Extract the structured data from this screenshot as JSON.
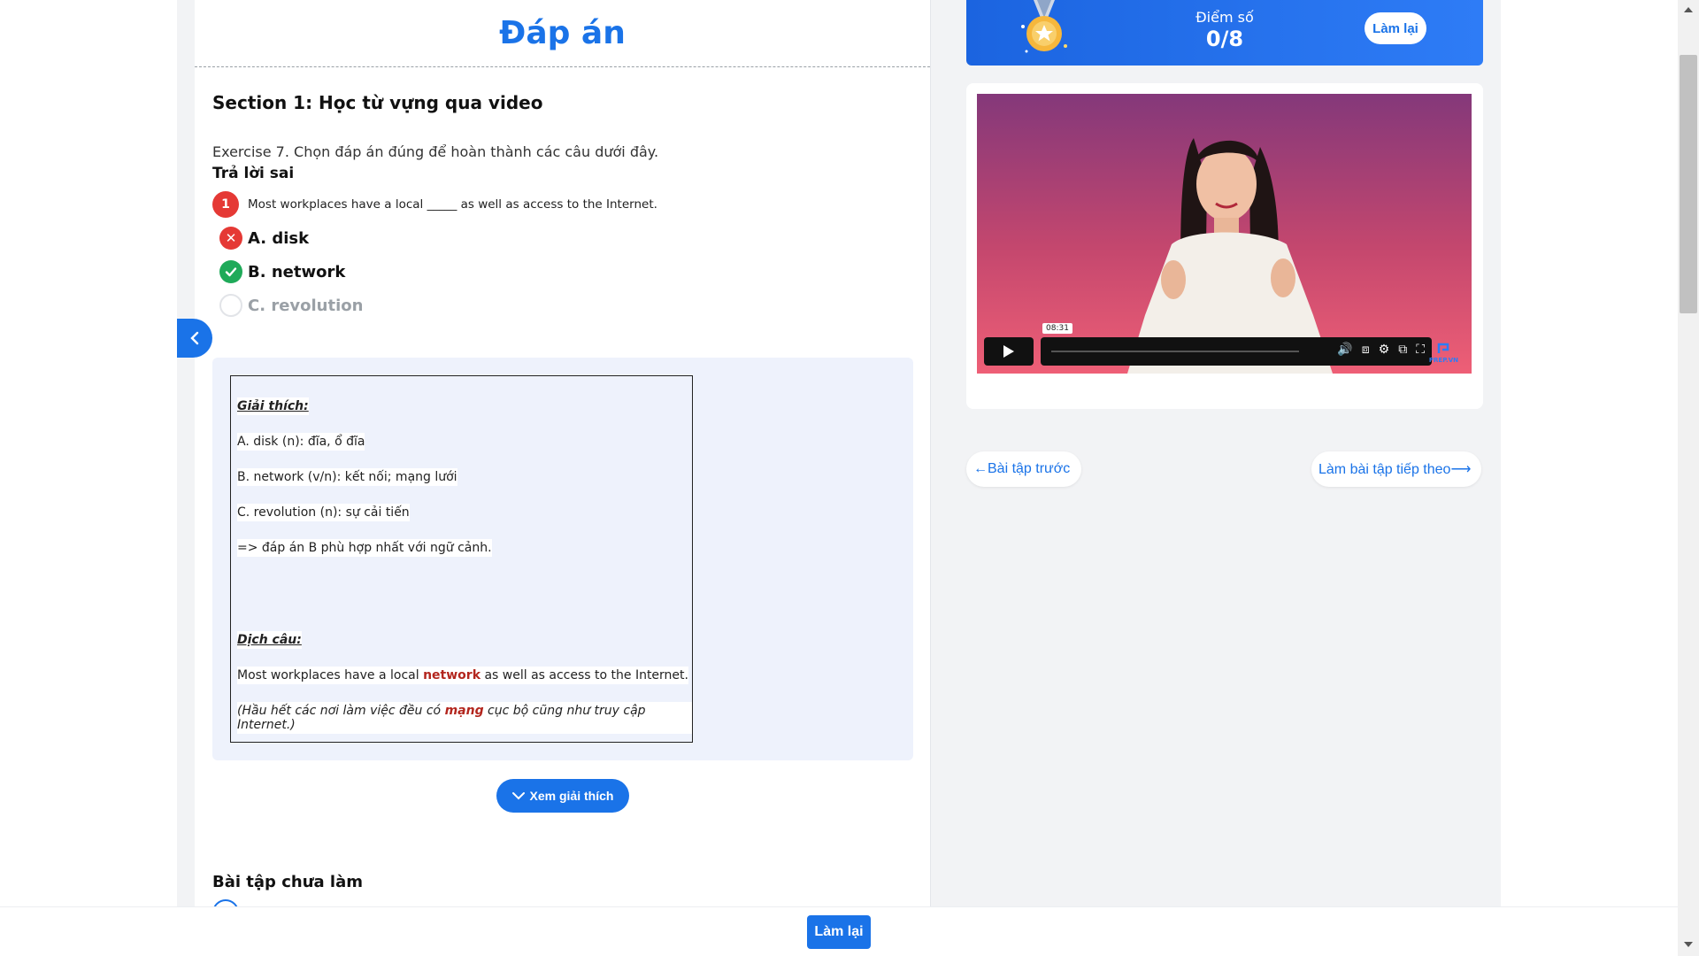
{
  "header": {
    "title": "Đáp án"
  },
  "section": {
    "title": "Section 1: Học từ vựng qua video"
  },
  "exercise": {
    "description": "Exercise 7. Chọn đáp án đúng để hoàn thành các câu dưới đây.",
    "result_label": "Trả lời sai",
    "question": {
      "number": "1",
      "text": "Most workplaces have a local _____ as well as access to the Internet.",
      "options": [
        {
          "label": "A. disk",
          "status": "wrong"
        },
        {
          "label": "B. network",
          "status": "correct"
        },
        {
          "label": "C. revolution",
          "status": "unselected"
        }
      ]
    },
    "explanation": {
      "heading": "Giải thích:",
      "lines": [
        "A. disk (n): đĩa, ổ đĩa",
        "B. network (v/n): kết nối; mạng lưới",
        "C. revolution (n): sự cải tiến",
        "=> đáp án B phù hợp nhất với ngữ cảnh."
      ],
      "translation_heading": "Dịch câu:",
      "sentence_before": "Most workplaces have a local ",
      "sentence_highlight": "network",
      "sentence_after": " as well as access to the Internet.",
      "translation_before": "(Hầu hết các nơi làm việc đều có ",
      "translation_highlight": "mạng",
      "translation_after": " cục bộ cũng như truy cập Internet.)"
    },
    "toggle_label": "Xem giải thích"
  },
  "unanswered": {
    "label": "Bài tập chưa làm"
  },
  "score": {
    "label": "Điểm số",
    "value": "0/8",
    "retry_label": "Làm lại"
  },
  "video": {
    "timestamp": "08:31",
    "brand": "PREP.VN"
  },
  "navigation": {
    "prev_label": "←Bài tập trước",
    "next_label": "Làm bài tập tiếp theo⟶"
  },
  "footer": {
    "retry_label": "Làm lại"
  },
  "icons": {
    "collapse": "chevron-left-icon",
    "wrong": "x-circle-icon",
    "correct": "check-circle-icon",
    "medal": "medal-icon",
    "play": "play-icon"
  },
  "colors": {
    "accent": "#1a73e8",
    "wrong": "#e53935",
    "correct": "#1faa59",
    "highlight": "#b3261e"
  }
}
